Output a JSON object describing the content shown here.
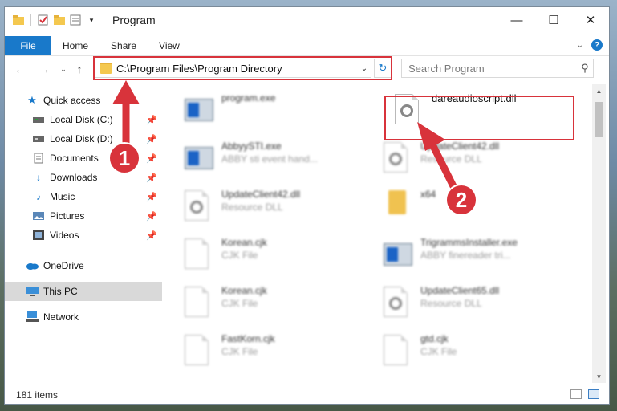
{
  "window": {
    "title": "Program",
    "controls": {
      "minimize": "—",
      "maximize": "☐",
      "close": "✕"
    }
  },
  "ribbon": {
    "tabs": [
      "File",
      "Home",
      "Share",
      "View"
    ]
  },
  "address_bar": {
    "path": "C:\\Program Files\\Program Directory",
    "search_placeholder": "Search Program"
  },
  "sidebar": {
    "quick_access": "Quick access",
    "items": [
      {
        "label": "Local Disk (C:)",
        "icon": "drive-icon",
        "pinned": true
      },
      {
        "label": "Local Disk (D:)",
        "icon": "drive-icon",
        "pinned": true
      },
      {
        "label": "Documents",
        "icon": "documents-icon",
        "pinned": true
      },
      {
        "label": "Downloads",
        "icon": "download-icon",
        "pinned": true
      },
      {
        "label": "Music",
        "icon": "music-icon",
        "pinned": true
      },
      {
        "label": "Pictures",
        "icon": "pictures-icon",
        "pinned": true
      },
      {
        "label": "Videos",
        "icon": "videos-icon",
        "pinned": true
      }
    ],
    "onedrive": "OneDrive",
    "this_pc": "This PC",
    "network": "Network"
  },
  "files": [
    {
      "name": "program.exe",
      "sub": "",
      "icon": "exe"
    },
    {
      "name": "dareaudioscript.dll",
      "sub": "",
      "icon": "dll"
    },
    {
      "name": "AbbyySTI.exe",
      "sub": "ABBY sti event hand...",
      "icon": "exe"
    },
    {
      "name": "UpdateClient42.dll",
      "sub": "Resource DLL",
      "icon": "dll"
    },
    {
      "name": "UpdateClient42.dll",
      "sub": "Resource DLL",
      "icon": "dll"
    },
    {
      "name": "x64",
      "sub": "",
      "icon": "folder"
    },
    {
      "name": "Korean.cjk",
      "sub": "CJK File",
      "icon": "doc"
    },
    {
      "name": "TrigrammsInstaller.exe",
      "sub": "ABBY finereader tri...",
      "icon": "exe"
    },
    {
      "name": "Korean.cjk",
      "sub": "CJK File",
      "icon": "doc"
    },
    {
      "name": "UpdateClient65.dll",
      "sub": "Resource DLL",
      "icon": "dll"
    },
    {
      "name": "FastKorn.cjk",
      "sub": "CJK File",
      "icon": "doc"
    },
    {
      "name": "gtd.cjk",
      "sub": "CJK File",
      "icon": "doc"
    }
  ],
  "status": {
    "item_count": "181 items"
  },
  "annotations": {
    "step1": "1",
    "step2": "2",
    "color": "#d8333b"
  }
}
